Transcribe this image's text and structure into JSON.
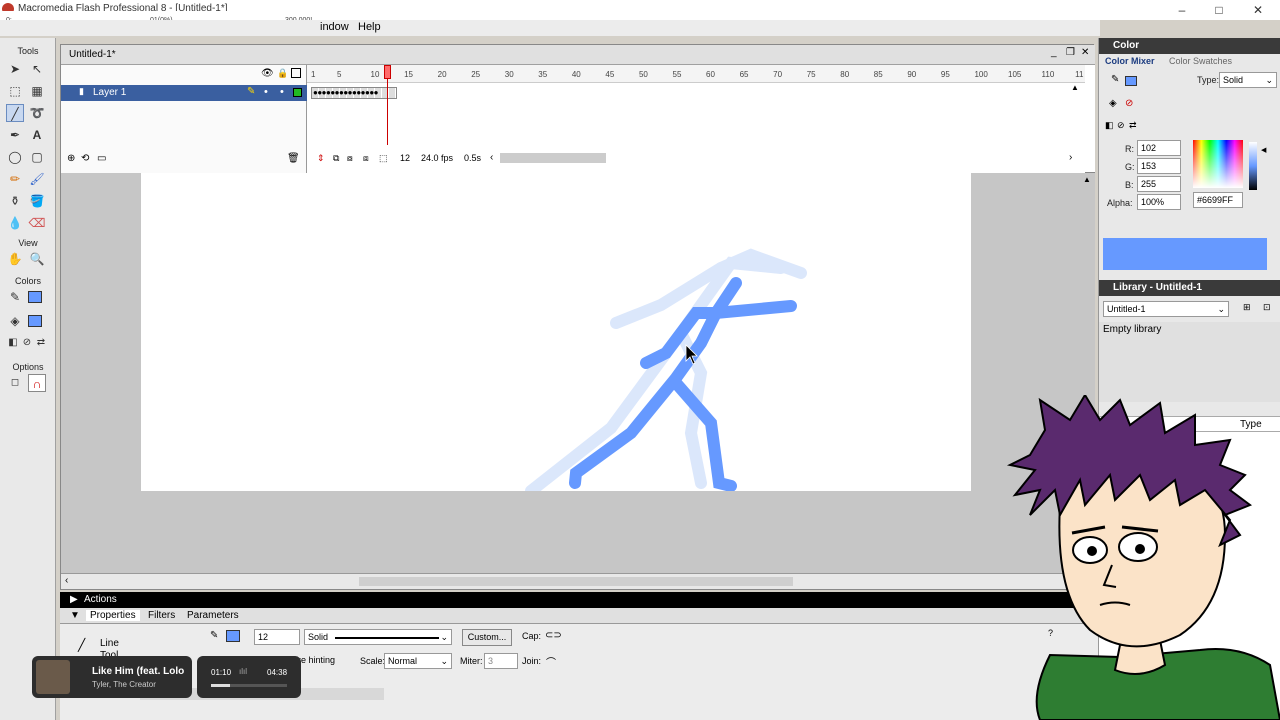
{
  "window": {
    "title": "Macromedia Flash Professional 8 - [Untitled-1*]",
    "minimize": "–",
    "maximize": "□",
    "close": "✕"
  },
  "overlay_bar": {
    "left": "0:",
    "mid": "01(0%)",
    "right": "300,000!"
  },
  "menu": {
    "window": "indow",
    "help": "Help"
  },
  "tools": {
    "tools_label": "Tools",
    "view_label": "View",
    "colors_label": "Colors",
    "options_label": "Options"
  },
  "document": {
    "tab": "Untitled-1*",
    "layer_name": "Layer 1",
    "ruler": [
      "1",
      "5",
      "10",
      "15",
      "20",
      "25",
      "30",
      "35",
      "40",
      "45",
      "50",
      "55",
      "60",
      "65",
      "70",
      "75",
      "80",
      "85",
      "90",
      "95",
      "100",
      "105",
      "110",
      "11"
    ],
    "current_frame": "12",
    "fps": "24.0 fps",
    "time": "0.5s"
  },
  "color_panel": {
    "title": "Color",
    "tab_mixer": "Color Mixer",
    "tab_swatches": "Color Swatches",
    "type_label": "Type:",
    "type_value": "Solid",
    "r_label": "R:",
    "r_value": "102",
    "g_label": "G:",
    "g_value": "153",
    "b_label": "B:",
    "b_value": "255",
    "alpha_label": "Alpha:",
    "alpha_value": "100%",
    "hex_value": "#6699FF",
    "swatch_color": "#6699ff"
  },
  "library": {
    "title": "Library - Untitled-1",
    "select_value": "Untitled-1",
    "empty_text": "Empty library",
    "col_type": "Type"
  },
  "bottom": {
    "actions": "Actions",
    "tab_properties": "Properties",
    "tab_filters": "Filters",
    "tab_parameters": "Parameters",
    "tool_name_line1": "Line",
    "tool_name_line2": "Tool",
    "stroke_size": "12",
    "stroke_style": "Solid",
    "custom_button": "Custom...",
    "cap_label": "Cap:",
    "hinting_label": "Stroke hinting",
    "scale_label": "Scale:",
    "scale_value": "Normal",
    "miter_label": "Miter:",
    "miter_value": "3",
    "join_label": "Join:"
  },
  "media": {
    "track": "Like Him (feat. Lolo",
    "artist": "Tyler, The Creator",
    "elapsed": "01:10",
    "total": "04:38",
    "progress": 0.25
  }
}
